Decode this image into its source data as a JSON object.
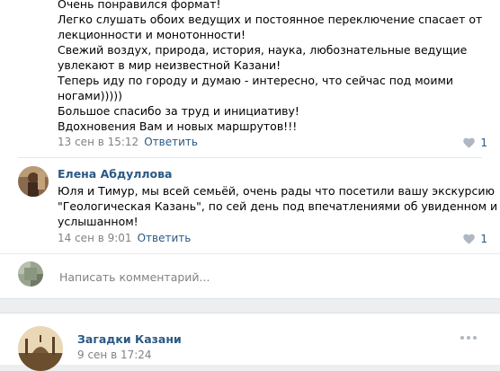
{
  "comment1": {
    "lines": [
      "Очень понравился формат!",
      "Легко слушать обоих ведущих и постоянное переключение спасает от",
      "лекционности и монотонности!",
      "Свежий воздух, природа, история, наука, любознательные ведущие",
      "увлекают в мир неизвестной Казани!",
      "Теперь иду по городу и думаю - интересно, что сейчас под моими",
      "ногами)))))",
      "Большое спасибо за труд и инициативу!",
      "Вдохновения Вам и новых маршрутов!!!"
    ],
    "date": "13 сен в 15:12",
    "reply": "Ответить",
    "likes": "1"
  },
  "comment2": {
    "author": "Елена Абдуллова",
    "lines": [
      "Юля и Тимур, мы всей семьёй, очень рады что посетили вашу экскурсию",
      "\"Геологическая Казань\", по сей день под впечатлениями об увиденном и",
      "услышанном!"
    ],
    "date": "14 сен в 9:01",
    "reply": "Ответить",
    "likes": "1"
  },
  "composer": {
    "placeholder": "Написать комментарий..."
  },
  "post": {
    "author": "Загадки Казани",
    "date": "9 сен в 17:24"
  },
  "colors": {
    "link": "#2a5885",
    "meta": "#828282",
    "background": "#edeef0"
  },
  "icons": {
    "like": "heart-icon",
    "more": "more-dots-icon"
  }
}
